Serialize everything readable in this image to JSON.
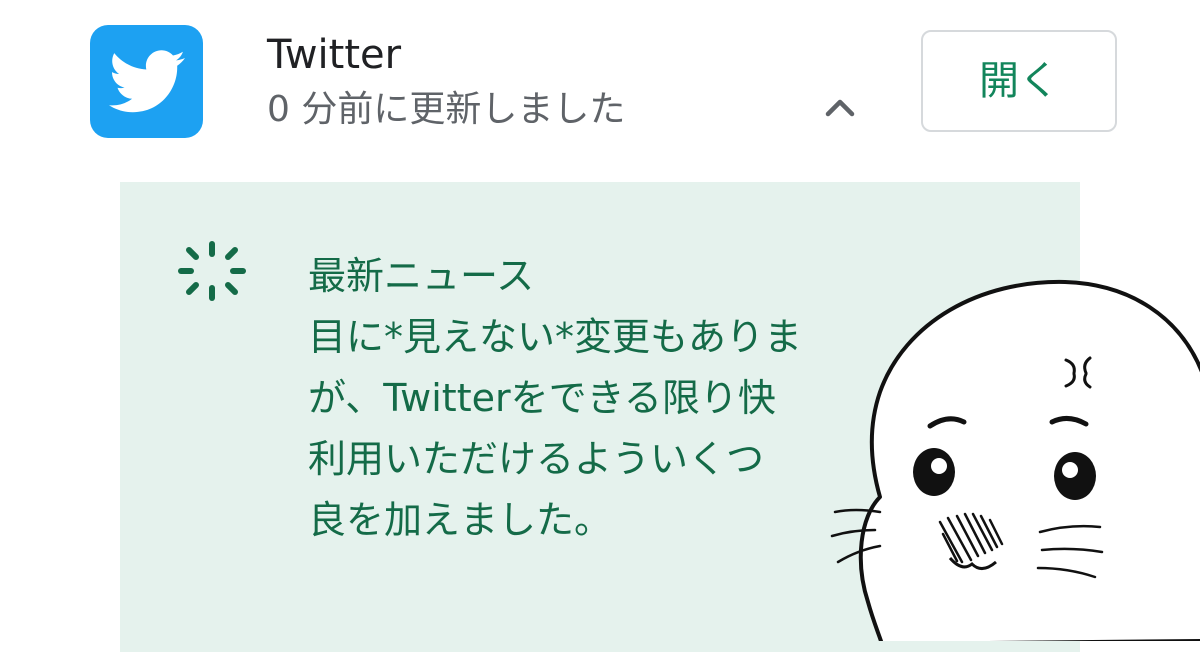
{
  "app": {
    "name": "Twitter",
    "updated": "0 分前に更新しました",
    "open_label": "開く",
    "icon": "twitter-bird-icon",
    "brand_color": "#1da1f2"
  },
  "news": {
    "icon": "sparkle-icon",
    "lines": [
      "最新ニュース",
      "目に*見えない*変更もありま",
      "が、Twitterをできる限り快",
      "利用いただけるよういくつ",
      "良を加えました。"
    ],
    "accent_color": "#146b48",
    "background": "#e5f2ed"
  },
  "illustration": {
    "name": "angry-seal-illustration"
  }
}
